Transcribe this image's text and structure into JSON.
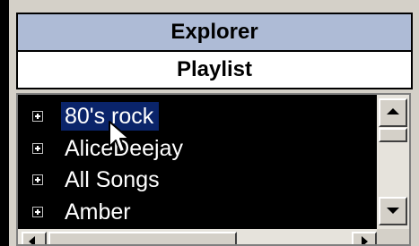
{
  "tabs": {
    "explorer_label": "Explorer",
    "playlist_label": "Playlist"
  },
  "tree": {
    "items": [
      {
        "label": "80's rock",
        "selected": true
      },
      {
        "label": "AliceDeejay",
        "selected": false
      },
      {
        "label": "All Songs",
        "selected": false
      },
      {
        "label": "Amber",
        "selected": false
      }
    ]
  },
  "colors": {
    "tab_active": "#aebbd6",
    "selection": "#0a246a",
    "list_background": "#000000",
    "text": "#ffffff"
  },
  "icons": {
    "expander": "plus-box-icon",
    "cursor": "mouse-pointer-icon"
  }
}
